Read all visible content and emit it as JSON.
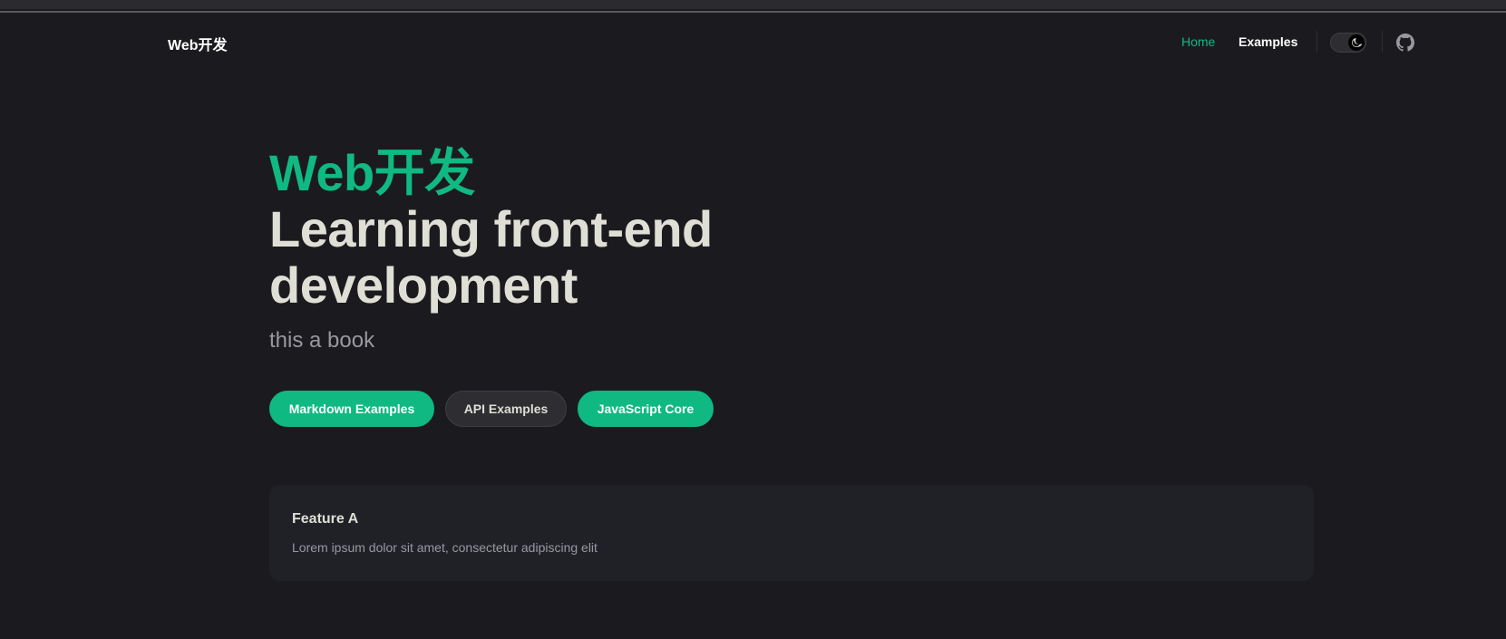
{
  "nav": {
    "brand": "Web开发",
    "links": [
      {
        "label": "Home",
        "active": true
      },
      {
        "label": "Examples",
        "active": false
      }
    ],
    "appearance_icon": "moon-icon",
    "social_icon": "github-icon"
  },
  "hero": {
    "name": "Web开发",
    "text": "Learning front-end development",
    "tagline": "this a book",
    "actions": [
      {
        "label": "Markdown Examples",
        "theme": "brand"
      },
      {
        "label": "API Examples",
        "theme": "alt"
      },
      {
        "label": "JavaScript Core",
        "theme": "brand"
      }
    ]
  },
  "features": [
    {
      "title": "Feature A",
      "details": "Lorem ipsum dolor sit amet, consectetur adipiscing elit"
    }
  ],
  "colors": {
    "brand": "#10b981",
    "background": "#1b1b1f",
    "card": "#202127",
    "text": "#dfdfd6",
    "muted": "#98989f"
  }
}
